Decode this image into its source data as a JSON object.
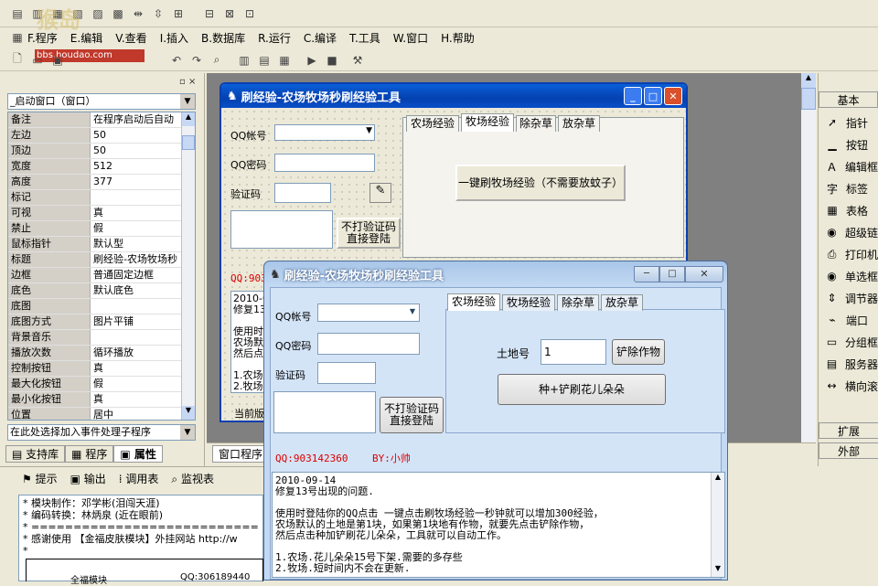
{
  "toolbar_top": {
    "icons": [
      "align-left-icon",
      "align-center-icon",
      "align-right-icon",
      "align-top-icon",
      "align-mid-icon",
      "align-bottom-icon",
      "spacing-h-icon",
      "spacing-v-icon",
      "size-icon",
      "center-icon"
    ]
  },
  "menu": [
    "F.程序",
    "E.编辑",
    "V.查看",
    "I.插入",
    "B.数据库",
    "R.运行",
    "C.编译",
    "T.工具",
    "W.窗口",
    "H.帮助"
  ],
  "watermark": "bbs.houdao.com",
  "props_panel": {
    "title": "_启动窗口（窗口）",
    "rows": [
      [
        "备注",
        "在程序启动后自动"
      ],
      [
        "左边",
        "50"
      ],
      [
        "顶边",
        "50"
      ],
      [
        "宽度",
        "512"
      ],
      [
        "高度",
        "377"
      ],
      [
        "标记",
        ""
      ],
      [
        "可视",
        "真"
      ],
      [
        "禁止",
        "假"
      ],
      [
        "鼠标指针",
        "默认型"
      ],
      [
        "标题",
        "刷经验-农场牧场秒"
      ],
      [
        "边框",
        "普通固定边框"
      ],
      [
        "底色",
        "默认底色"
      ],
      [
        "底图",
        ""
      ],
      [
        "  底图方式",
        "图片平铺"
      ],
      [
        "背景音乐",
        ""
      ],
      [
        "  播放次数",
        "循环播放"
      ],
      [
        "控制按钮",
        "真"
      ],
      [
        "  最大化按钮",
        "假"
      ],
      [
        "  最小化按钮",
        "真"
      ],
      [
        "位置",
        "居中"
      ]
    ],
    "event_select": "在此处选择加入事件处理子程序",
    "tabs": [
      "支持库",
      "程序",
      "属性"
    ]
  },
  "designer_tabs": [
    "窗口程序"
  ],
  "bottom_tabs": [
    "提示",
    "输出",
    "调用表",
    "监视表"
  ],
  "output_lines": [
    "* 模块制作：邓学彬(泪闯天涯)",
    "* 编码转换：林炳泉 (近在眼前)",
    "* ===========================",
    "* 感谢使用 【金福皮肤模块】外挂网站 http://w",
    "*"
  ],
  "output_tail": [
    "全福模块",
    "QQ:306189440"
  ],
  "right_panel": {
    "header": "基本",
    "tools": [
      {
        "icon": "pointer-icon",
        "label": "指针"
      },
      {
        "icon": "button-icon",
        "label": "按钮"
      },
      {
        "icon": "editbox-icon",
        "label": "编辑框"
      },
      {
        "icon": "label-icon",
        "label": "标签"
      },
      {
        "icon": "table-icon",
        "label": "表格"
      },
      {
        "icon": "hyperlink-icon",
        "label": "超级链"
      },
      {
        "icon": "printer-icon",
        "label": "打印机"
      },
      {
        "icon": "radio-icon",
        "label": "单选框"
      },
      {
        "icon": "adjuster-icon",
        "label": "调节器"
      },
      {
        "icon": "port-icon",
        "label": "端口"
      },
      {
        "icon": "groupbox-icon",
        "label": "分组框"
      },
      {
        "icon": "server-icon",
        "label": "服务器"
      },
      {
        "icon": "hscroll-icon",
        "label": "横向滚"
      }
    ],
    "footer": [
      "扩展",
      "外部"
    ]
  },
  "design_win": {
    "title": "刷经验-农场牧场秒刷经验工具",
    "qq_label": "QQ帐号",
    "pwd_label": "QQ密码",
    "code_label": "验证码",
    "login_btn": "不打验证码\n直接登陆",
    "tabs": [
      "农场经验",
      "牧场经验",
      "除杂草",
      "放杂草"
    ],
    "main_btn": "一键刷牧场经验（不需要放蚊子）",
    "qq_red": "QQ:903",
    "log_lines": [
      "2010-0",
      "修复13",
      "",
      "使用时",
      "农场默",
      "然后点",
      "",
      "1.农场",
      "2.牧场"
    ],
    "status": "当前版"
  },
  "run_win": {
    "title": "刷经验-农场牧场秒刷经验工具",
    "qq_label": "QQ帐号",
    "pwd_label": "QQ密码",
    "code_label": "验证码",
    "login_btn": "不打验证码\n直接登陆",
    "tabs": [
      "农场经验",
      "牧场经验",
      "除杂草",
      "放杂草"
    ],
    "land_label": "土地号",
    "land_value": "1",
    "remove_btn": "铲除作物",
    "plant_btn": "种+铲刷花儿朵朵",
    "qq_info": "QQ:903142360    BY:小帅",
    "log": [
      "2010-09-14",
      "修复13号出现的问题.",
      "",
      "使用时登陆你的QQ点击 一键点击刷牧场经验一秒钟就可以增加300经验，",
      "农场默认的土地是第1块，如果第1块地有作物，就要先点击铲除作物，",
      "然后点击种加铲刷花儿朵朵，工具就可以自动工作。",
      "",
      "1.农场.花儿朵朵15号下架.需要的多存些",
      "2.牧场.短时间内不会在更新."
    ]
  }
}
